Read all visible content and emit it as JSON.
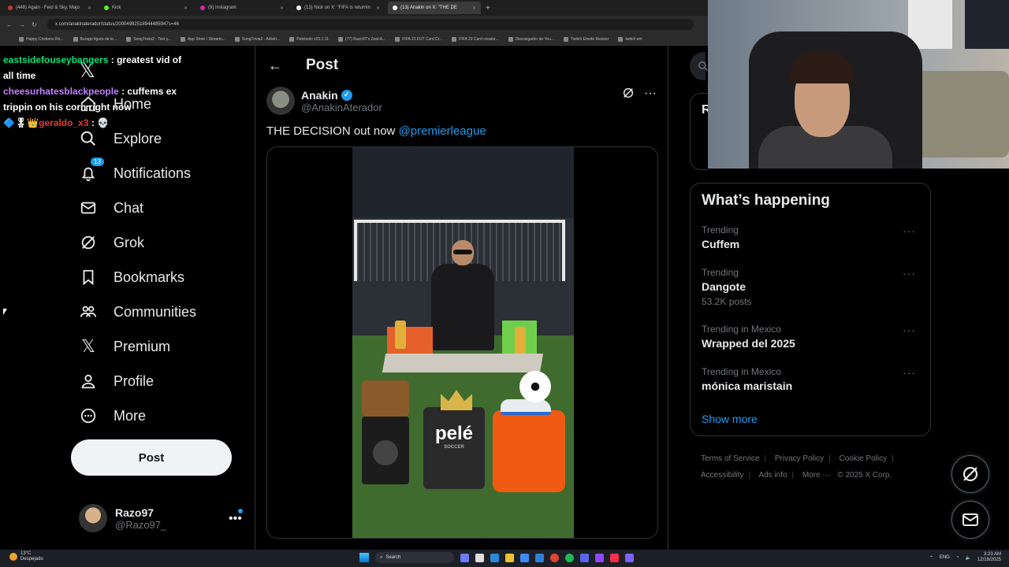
{
  "browser": {
    "tabs": [
      {
        "label": "(448) Again - Feid & Sky, Majo",
        "active": false
      },
      {
        "label": "Kick",
        "active": false
      },
      {
        "label": "(9) Instagram",
        "active": false
      },
      {
        "label": "(13) Nick on X: \"FIFA is returnin",
        "active": false
      },
      {
        "label": "(13) Anakin on X: \"THE DE",
        "active": true
      }
    ],
    "new_tab": "+",
    "url": "x.com/anakinaterador/status/20004992518944485947s=46",
    "bookmarks": [
      "Happy Cristiano Ro...",
      "Burago figura de to...",
      "SongTrivia2 - Test y...",
      "App Store / Streami...",
      "SongTrivia2 - Adivin...",
      "Peletools v25.1.11",
      "(77) Razo97's Zeal-A...",
      "FIFA 23 FUT Card Cr...",
      "FIFA 23 Card creator...",
      "Descargador de You...",
      "Twitch Emote Resizer",
      "twitch em"
    ]
  },
  "chat": [
    {
      "user": "eastsidefouseybangers",
      "text": ": greatest vid of all time"
    },
    {
      "user": "cheesurhatesblackpeople",
      "text": ": cuffems ex trippin on his corn right now"
    },
    {
      "user": "geraldo_x3",
      "text": ": 💀"
    }
  ],
  "nav": {
    "logo": "𝕏",
    "items": [
      {
        "label": "Home",
        "icon": "home-icon"
      },
      {
        "label": "Explore",
        "icon": "search-icon"
      },
      {
        "label": "Notifications",
        "icon": "bell-icon",
        "badge": "13"
      },
      {
        "label": "Chat",
        "icon": "mail-icon"
      },
      {
        "label": "Grok",
        "icon": "grok-icon"
      },
      {
        "label": "Bookmarks",
        "icon": "bookmark-icon"
      },
      {
        "label": "Communities",
        "icon": "communities-icon"
      },
      {
        "label": "Premium",
        "icon": "x-logo-icon"
      },
      {
        "label": "Profile",
        "icon": "profile-icon"
      },
      {
        "label": "More",
        "icon": "more-circle-icon"
      }
    ],
    "post_button": "Post",
    "account": {
      "name": "Razo97",
      "handle": "@Razo97_",
      "more": "•••"
    }
  },
  "main": {
    "title": "Post",
    "author": {
      "name": "Anakin",
      "handle": "@AnakinAterador",
      "verified": true
    },
    "text": "THE DECISION out now ",
    "mention": "@premierleague",
    "more": "···"
  },
  "media_labels": {
    "brand": "pelé",
    "brand_sub": "SOCCER"
  },
  "sidebar": {
    "partial_card_letter": "R",
    "happening_title": "What’s happening",
    "trends": [
      {
        "context": "Trending",
        "title": "Cuffem",
        "count": ""
      },
      {
        "context": "Trending",
        "title": "Dangote",
        "count": "53.2K posts"
      },
      {
        "context": "Trending in Mexico",
        "title": "Wrapped del 2025",
        "count": ""
      },
      {
        "context": "Trending in Mexico",
        "title": "mónica maristain",
        "count": ""
      }
    ],
    "trend_more": "···",
    "show_more": "Show more",
    "footer": {
      "links": [
        "Terms of Service",
        "Privacy Policy",
        "Cookie Policy",
        "Accessibility",
        "Ads info",
        "More ···"
      ],
      "copyright": "© 2025 X Corp."
    }
  },
  "taskbar": {
    "temp": "13°C",
    "weather": "Despejado",
    "search": "Search",
    "lang": "ENG",
    "time": "3:23 AM",
    "date": "12/18/2025"
  },
  "colors": {
    "accent": "#1d9bf0",
    "background": "#000000",
    "text": "#e7e9ea",
    "muted": "#71767b",
    "border": "#2f3336"
  }
}
